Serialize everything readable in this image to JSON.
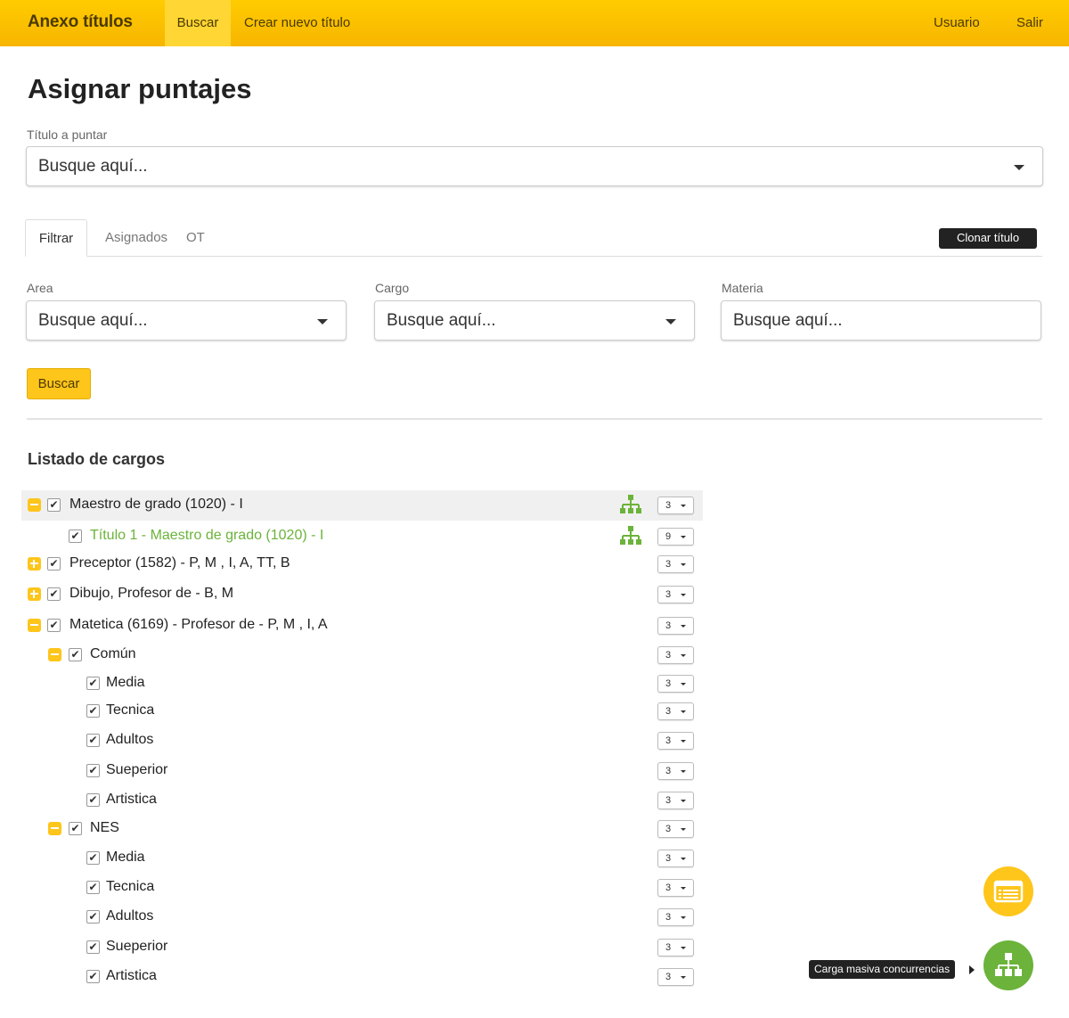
{
  "navbar": {
    "brand": "Anexo títulos",
    "items": [
      "Buscar",
      "Crear nuevo título"
    ],
    "right": [
      "Usuario",
      "Salir"
    ],
    "accent": "#ffcc00"
  },
  "page_title": "Asignar puntajes",
  "titulo_field": {
    "label": "Título a puntar",
    "placeholder": "Busque aquí..."
  },
  "tabs": [
    "Filtrar",
    "Asignados",
    "OT"
  ],
  "clone_button": "Clonar título",
  "filters": {
    "area": {
      "label": "Area",
      "placeholder": "Busque aquí..."
    },
    "cargo": {
      "label": "Cargo",
      "placeholder": "Busque aquí..."
    },
    "materia": {
      "label": "Materia",
      "placeholder": "Busque aquí..."
    }
  },
  "search_button": "Buscar",
  "list_title": "Listado de cargos",
  "tree": [
    {
      "label": "Maestro de grado (1020) - I",
      "value": "3",
      "toggle": "minus",
      "level": 0,
      "icon": true,
      "highlight": true
    },
    {
      "label": "Título 1 - Maestro de grado (1020) - I",
      "value": "9",
      "toggle": null,
      "level": 1,
      "icon": true,
      "green": true
    },
    {
      "label": "Preceptor (1582) - P, M , I, A, TT, B",
      "value": "3",
      "toggle": "plus",
      "level": 0
    },
    {
      "label": "Dibujo, Profesor de - B, M",
      "value": "3",
      "toggle": "plus",
      "level": 0
    },
    {
      "label": "Matetica (6169) - Profesor de - P, M , I, A",
      "value": "3",
      "toggle": "minus",
      "level": 0
    },
    {
      "label": "Común",
      "value": "3",
      "toggle": "minus",
      "level": 1
    },
    {
      "label": "Media",
      "value": "3",
      "toggle": null,
      "level": 2
    },
    {
      "label": "Tecnica",
      "value": "3",
      "toggle": null,
      "level": 2
    },
    {
      "label": "Adultos",
      "value": "3",
      "toggle": null,
      "level": 2
    },
    {
      "label": "Sueperior",
      "value": "3",
      "toggle": null,
      "level": 2
    },
    {
      "label": "Artistica",
      "value": "3",
      "toggle": null,
      "level": 2
    },
    {
      "label": "NES",
      "value": "3",
      "toggle": "minus",
      "level": 1
    },
    {
      "label": "Media",
      "value": "3",
      "toggle": null,
      "level": 2
    },
    {
      "label": "Tecnica",
      "value": "3",
      "toggle": null,
      "level": 2
    },
    {
      "label": "Adultos",
      "value": "3",
      "toggle": null,
      "level": 2
    },
    {
      "label": "Sueperior",
      "value": "3",
      "toggle": null,
      "level": 2
    },
    {
      "label": "Artistica",
      "value": "3",
      "toggle": null,
      "level": 2
    }
  ],
  "fabs": {
    "list_icon": "list-icon",
    "tree_icon": "org-chart-icon",
    "tooltip": "Carga masiva concurrencias"
  }
}
